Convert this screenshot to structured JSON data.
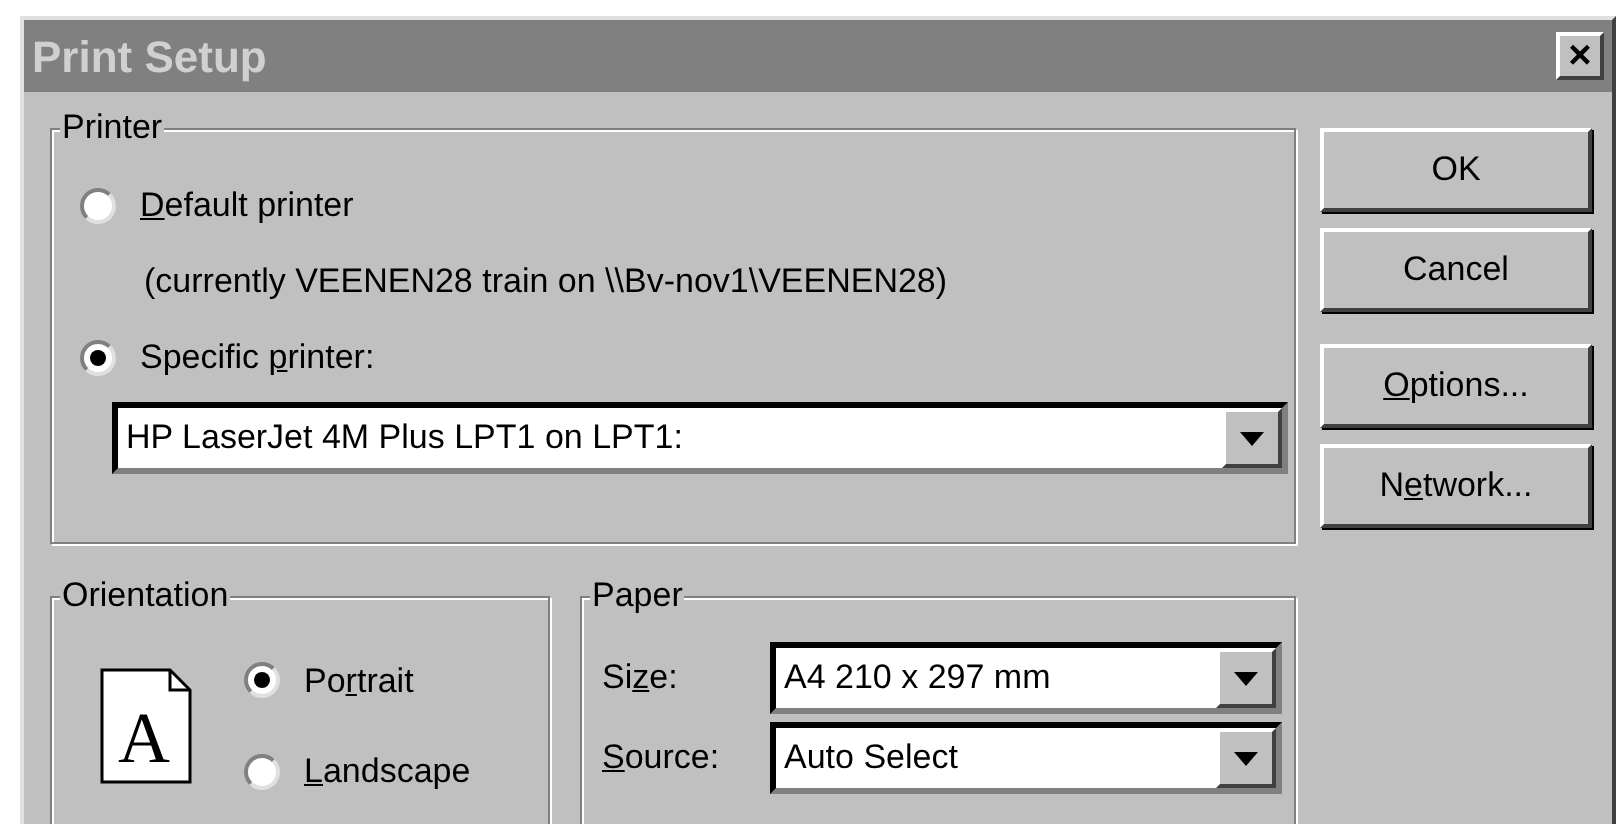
{
  "window": {
    "title": "Print Setup",
    "close": "×"
  },
  "printer": {
    "title": "Printer",
    "options": [
      {
        "label": {
          "key": "D",
          "post": "efault printer"
        },
        "selected": false,
        "detail": "(currently VEENEN28 train on \\\\Bv-nov1\\VEENEN28)"
      },
      {
        "label": {
          "pre": "Specific ",
          "key": "p",
          "post": "rinter:"
        },
        "selected": true
      }
    ],
    "dropdown": {
      "value": "HP LaserJet 4M Plus LPT1 on LPT1:"
    }
  },
  "buttons": [
    {
      "label": {
        "post": "OK"
      }
    },
    {
      "label": {
        "post": "Cancel"
      }
    },
    {
      "label": {
        "key": "O",
        "post": "ptions..."
      }
    },
    {
      "label": {
        "pre": "N",
        "key": "e",
        "post": "twork..."
      }
    }
  ],
  "orientation": {
    "title": "Orientation",
    "icon_letter": "A",
    "options": [
      {
        "label": {
          "pre": "Po",
          "key": "r",
          "post": "trait"
        },
        "selected": true
      },
      {
        "label": {
          "key": "L",
          "post": "andscape"
        },
        "selected": false
      }
    ]
  },
  "paper": {
    "title": "Paper",
    "fields": [
      {
        "label": {
          "pre": "Si",
          "key": "z",
          "post": "e:"
        },
        "value": "A4 210 x 297 mm"
      },
      {
        "label": {
          "key": "S",
          "post": "ource:"
        },
        "value": "Auto Select"
      }
    ]
  }
}
